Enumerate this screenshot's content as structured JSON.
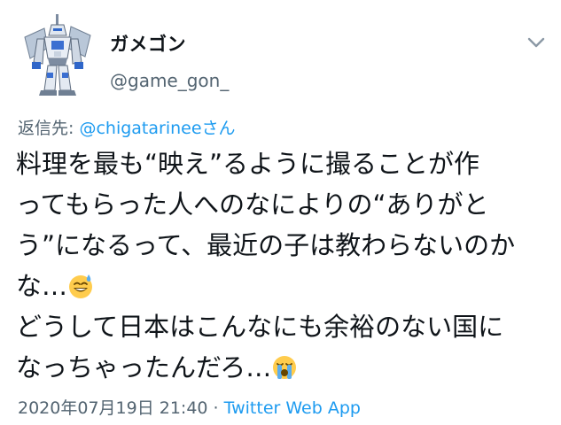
{
  "tweet": {
    "author": {
      "display_name": "ガメゴン",
      "handle": "@game_gon_"
    },
    "more_menu_icon": "chevron-down-icon",
    "reply_to": {
      "prefix": "返信先: ",
      "mention": "@chigatarinee",
      "suffix": "さん"
    },
    "text_lines": [
      "料理を最も“映え”るように撮ることが作",
      "ってもらった人へのなによりの“ありがと",
      "う”になるって、最近の子は教わらないのか",
      "な…",
      "どうして日本はこんなにも余裕のない国に",
      "なっちゃったんだろ…"
    ],
    "emojis": [
      "sweat-smile-emoji",
      "loudly-crying-emoji"
    ],
    "timestamp": "2020年07月19日 21:40",
    "separator": " · ",
    "source": "Twitter Web App",
    "colors": {
      "link": "#1d9bf0",
      "secondary": "#536471",
      "text": "#0f1419"
    }
  }
}
